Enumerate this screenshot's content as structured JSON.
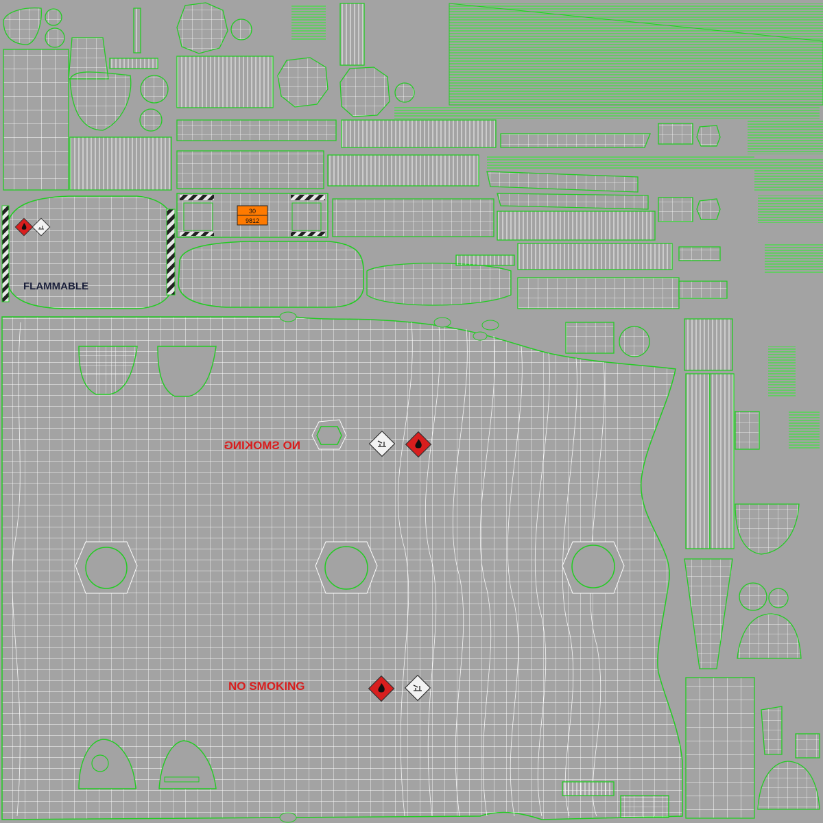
{
  "texture": {
    "background_color": "#a3a3a3",
    "wire_color": "#ffffff",
    "island_edge_color": "#22cc22",
    "label_red": "#d81e1e",
    "label_dark": "#1a1f3a",
    "plate_orange": "#ff7a00"
  },
  "labels": {
    "flammable": "FLAMMABLE",
    "no_smoking_mirrored": "NO SMOKING",
    "no_smoking": "NO SMOKING",
    "plate_top": "30",
    "plate_bottom": "9812"
  },
  "icons": {
    "flammable_diamond": "flammable-hazard-diamond-icon",
    "environment_diamond": "environmental-hazard-diamond-icon"
  }
}
